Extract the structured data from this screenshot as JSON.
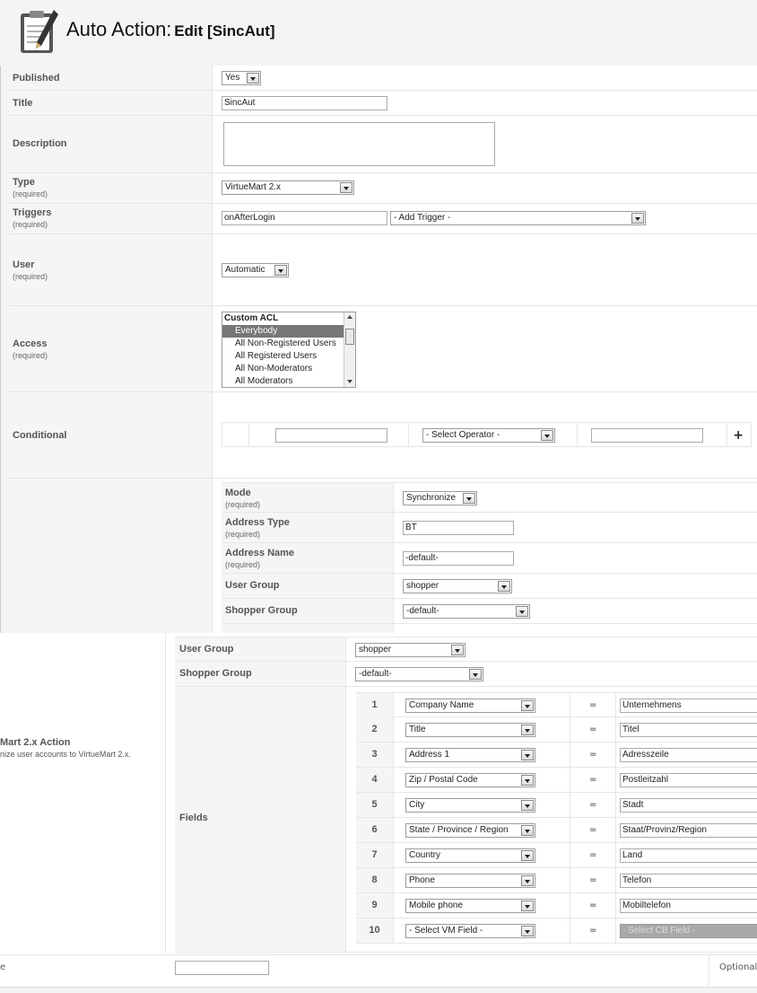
{
  "header": {
    "title_main": "Auto Action:",
    "title_sub": "Edit [SincAut]",
    "icon": "clipboard-pen-icon"
  },
  "form": {
    "published": {
      "label": "Published",
      "value": "Yes"
    },
    "title": {
      "label": "Title",
      "value": "SincAut"
    },
    "description": {
      "label": "Description",
      "value": ""
    },
    "type": {
      "label": "Type",
      "required": "(required)",
      "value": "VirtueMart 2.x"
    },
    "triggers": {
      "label": "Triggers",
      "required": "(required)",
      "value": "onAfterLogin",
      "add_trigger": "- Add Trigger -"
    },
    "user": {
      "label": "User",
      "required": "(required)",
      "value": "Automatic"
    },
    "access": {
      "label": "Access",
      "required": "(required)",
      "options": [
        "Custom ACL",
        "Everybody",
        "All Non-Registered Users",
        "All Registered Users",
        "All Non-Moderators",
        "All Moderators"
      ],
      "selected": "Everybody"
    },
    "conditional": {
      "label": "Conditional",
      "operator": "- Select Operator -",
      "add": "+"
    }
  },
  "action": {
    "mode": {
      "label": "Mode",
      "required": "(required)",
      "value": "Synchronize"
    },
    "address_type": {
      "label": "Address Type",
      "required": "(required)",
      "value": "BT"
    },
    "address_name": {
      "label": "Address Name",
      "required": "(required)",
      "value": "-default-"
    },
    "user_group": {
      "label": "User Group",
      "value": "shopper"
    },
    "shopper_group": {
      "label": "Shopper Group",
      "value": "-default-"
    }
  },
  "lower": {
    "section_title": "Mart 2.x Action",
    "section_desc": "nize user accounts to VirtueMart 2.x.",
    "user_group": {
      "label": "User Group",
      "value": "shopper"
    },
    "shopper_group": {
      "label": "Shopper Group",
      "value": "-default-"
    },
    "fields_label": "Fields",
    "eq": "=",
    "fields": [
      {
        "n": "1",
        "vm": "Company Name",
        "cb": "Unternehmens"
      },
      {
        "n": "2",
        "vm": "Title",
        "cb": "Titel"
      },
      {
        "n": "3",
        "vm": "Address 1",
        "cb": "Adresszeile"
      },
      {
        "n": "4",
        "vm": "Zip / Postal Code",
        "cb": "Postleitzahl"
      },
      {
        "n": "5",
        "vm": "City",
        "cb": "Stadt"
      },
      {
        "n": "6",
        "vm": "State / Province / Region",
        "cb": "Staat/Provinz/Region"
      },
      {
        "n": "7",
        "vm": "Country",
        "cb": "Land"
      },
      {
        "n": "8",
        "vm": "Phone",
        "cb": "Telefon"
      },
      {
        "n": "9",
        "vm": "Mobile phone",
        "cb": "Mobiltelefon"
      },
      {
        "n": "10",
        "vm": "- Select VM Field -",
        "cb": "- Select CB Field -"
      }
    ],
    "bottom_label": "e",
    "bottom_note": "Optionally"
  }
}
